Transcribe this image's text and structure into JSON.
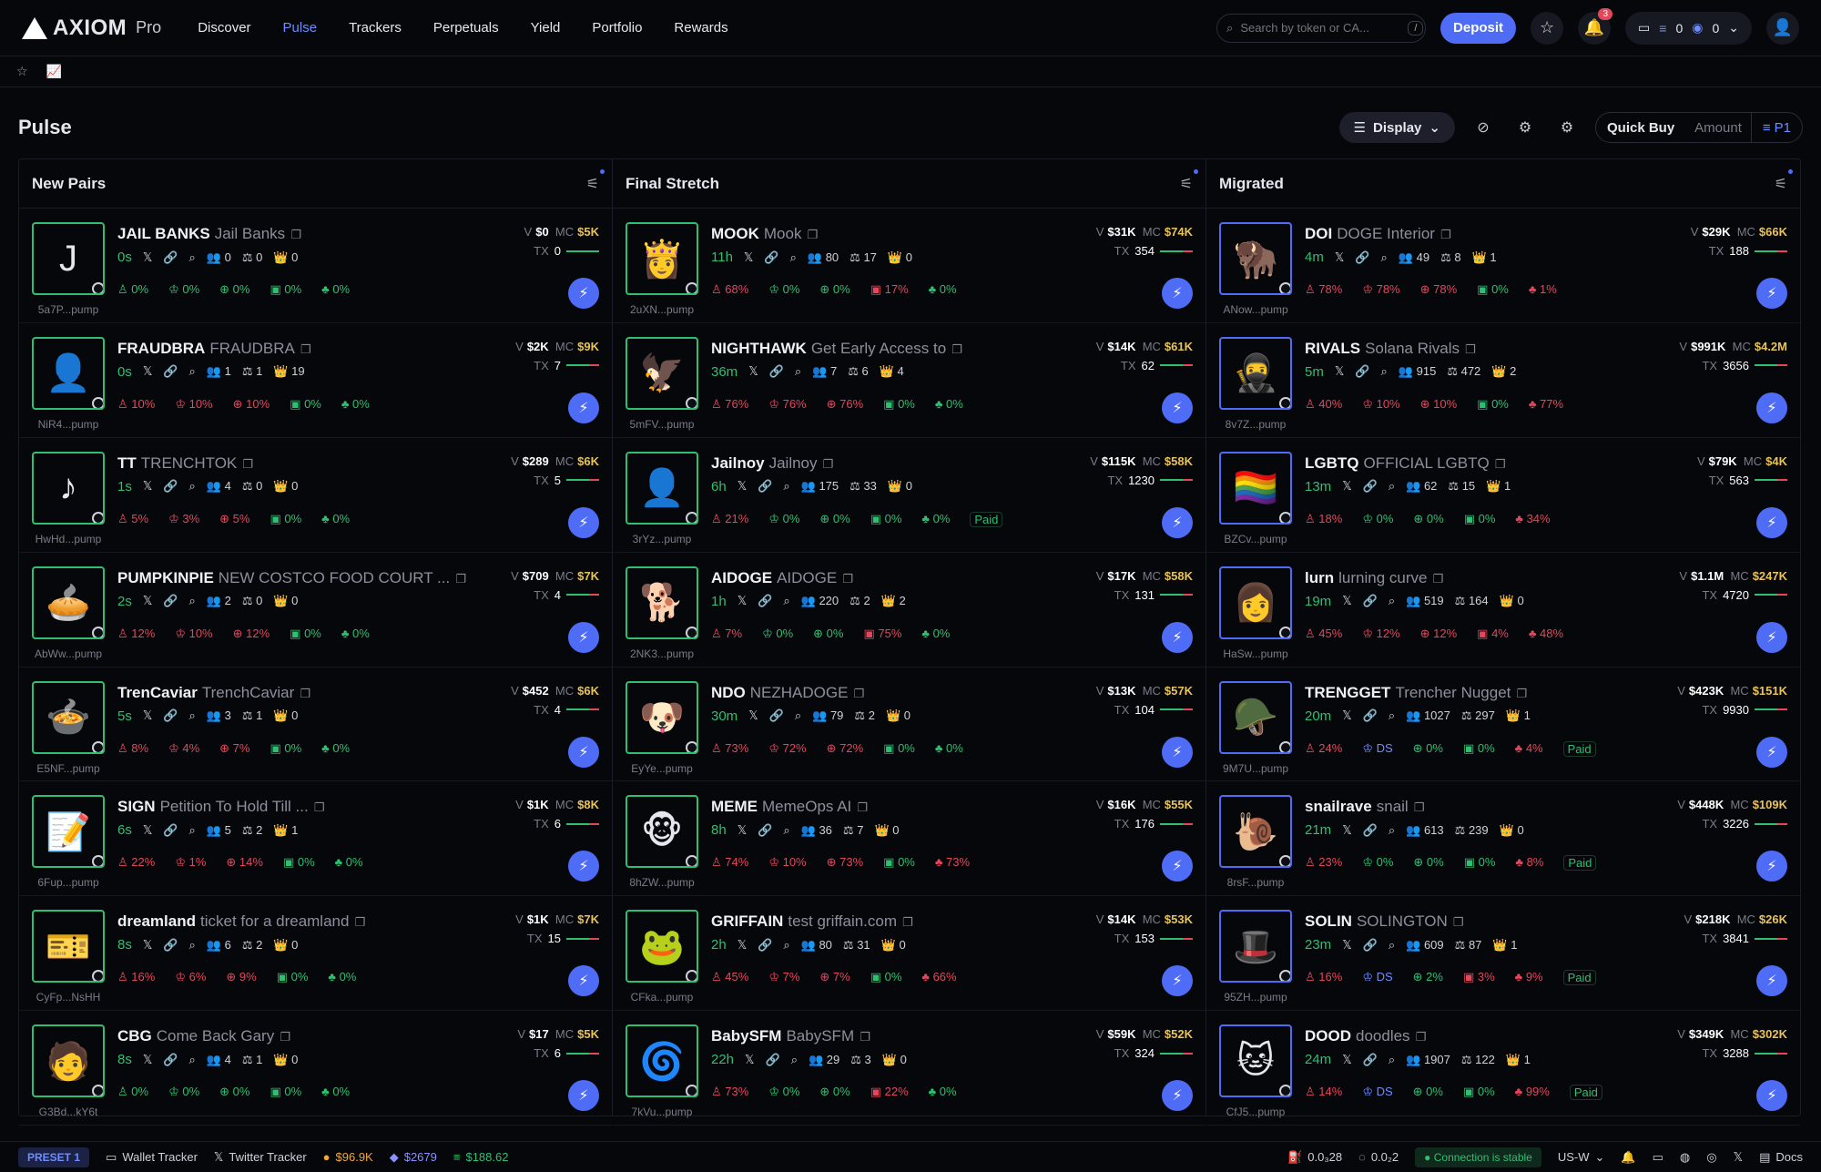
{
  "app": {
    "brand": "AXIOM",
    "brand_sub": "Pro"
  },
  "nav": [
    "Discover",
    "Pulse",
    "Trackers",
    "Perpetuals",
    "Yield",
    "Portfolio",
    "Rewards"
  ],
  "nav_active": "Pulse",
  "search": {
    "placeholder": "Search by token or CA...",
    "shortcut": "/"
  },
  "deposit_label": "Deposit",
  "notifications": "3",
  "wallet": {
    "sol": "0",
    "usdc": "0"
  },
  "page_title": "Pulse",
  "display_label": "Display",
  "quick_buy": {
    "label": "Quick Buy",
    "amount_placeholder": "Amount",
    "preset": "P1"
  },
  "columns": [
    {
      "title": "New Pairs",
      "rows": [
        {
          "sym": "JAIL BANKS",
          "name": "Jail Banks",
          "addr": "5a7P...pump",
          "age": "0s",
          "holders": "0",
          "pro": "0",
          "bundlers": "0",
          "p1": "0%",
          "p2": "0%",
          "p3": "0%",
          "p4": "0%",
          "p5": "0%",
          "v": "$0",
          "mc": "$5K",
          "tx": "0",
          "art": "J",
          "p3red": false
        },
        {
          "sym": "FRAUDBRA",
          "name": "FRAUDBRA",
          "addr": "NiR4...pump",
          "age": "0s",
          "holders": "1",
          "pro": "1",
          "bundlers": "19",
          "p1": "10%",
          "p2": "10%",
          "p3": "10%",
          "p4": "0%",
          "p5": "0%",
          "v": "$2K",
          "mc": "$9K",
          "tx": "7",
          "art": "👤",
          "p3red": true
        },
        {
          "sym": "TT",
          "name": "TRENCHTOK",
          "addr": "HwHd...pump",
          "age": "1s",
          "holders": "4",
          "pro": "0",
          "bundlers": "0",
          "p1": "5%",
          "p2": "3%",
          "p3": "5%",
          "p4": "0%",
          "p5": "0%",
          "v": "$289",
          "mc": "$6K",
          "tx": "5",
          "art": "♪",
          "p3red": true
        },
        {
          "sym": "PUMPKINPIE",
          "name": "NEW COSTCO FOOD COURT ...",
          "addr": "AbWw...pump",
          "age": "2s",
          "holders": "2",
          "pro": "0",
          "bundlers": "0",
          "p1": "12%",
          "p2": "10%",
          "p3": "12%",
          "p4": "0%",
          "p5": "0%",
          "v": "$709",
          "mc": "$7K",
          "tx": "4",
          "art": "🥧",
          "p3red": true
        },
        {
          "sym": "TrenCaviar",
          "name": "TrenchCaviar",
          "addr": "E5NF...pump",
          "age": "5s",
          "holders": "3",
          "pro": "1",
          "bundlers": "0",
          "p1": "8%",
          "p2": "4%",
          "p3": "7%",
          "p4": "0%",
          "p5": "0%",
          "v": "$452",
          "mc": "$6K",
          "tx": "4",
          "art": "🍲",
          "p3red": true
        },
        {
          "sym": "SIGN",
          "name": "Petition To Hold Till ...",
          "addr": "6Fup...pump",
          "age": "6s",
          "holders": "5",
          "pro": "2",
          "bundlers": "1",
          "p1": "22%",
          "p2": "1%",
          "p3": "14%",
          "p4": "0%",
          "p5": "0%",
          "v": "$1K",
          "mc": "$8K",
          "tx": "6",
          "art": "📝",
          "p3red": true
        },
        {
          "sym": "dreamland",
          "name": "ticket for a dreamland",
          "addr": "CyFp...NsHH",
          "age": "8s",
          "holders": "6",
          "pro": "2",
          "bundlers": "0",
          "p1": "16%",
          "p2": "6%",
          "p3": "9%",
          "p4": "0%",
          "p5": "0%",
          "v": "$1K",
          "mc": "$7K",
          "tx": "15",
          "art": "🎫",
          "p3red": true
        },
        {
          "sym": "CBG",
          "name": "Come Back Gary",
          "addr": "G3Bd...kY6t",
          "age": "8s",
          "holders": "4",
          "pro": "1",
          "bundlers": "0",
          "p1": "0%",
          "p2": "0%",
          "p3": "0%",
          "p4": "0%",
          "p5": "0%",
          "v": "$17",
          "mc": "$5K",
          "tx": "6",
          "art": "🧑",
          "p3red": false
        }
      ]
    },
    {
      "title": "Final Stretch",
      "rows": [
        {
          "sym": "MOOK",
          "name": "Mook",
          "addr": "2uXN...pump",
          "age": "11h",
          "holders": "80",
          "pro": "17",
          "bundlers": "0",
          "p1": "68%",
          "p2": "0%",
          "p3": "0%",
          "p4": "17%",
          "p5": "0%",
          "v": "$31K",
          "mc": "$74K",
          "tx": "354",
          "art": "👸",
          "p3red": false
        },
        {
          "sym": "NIGHTHAWK",
          "name": "Get Early Access to",
          "addr": "5mFV...pump",
          "age": "36m",
          "holders": "7",
          "pro": "6",
          "bundlers": "4",
          "p1": "76%",
          "p2": "76%",
          "p3": "76%",
          "p4": "0%",
          "p5": "0%",
          "v": "$14K",
          "mc": "$61K",
          "tx": "62",
          "art": "🦅",
          "p3red": true
        },
        {
          "sym": "Jailnoy",
          "name": "Jailnoy",
          "addr": "3rYz...pump",
          "age": "6h",
          "holders": "175",
          "pro": "33",
          "bundlers": "0",
          "p1": "21%",
          "p2": "0%",
          "p3": "0%",
          "p4": "0%",
          "p5": "0%",
          "v": "$115K",
          "mc": "$58K",
          "tx": "1230",
          "art": "👤",
          "p3red": false,
          "paid": "Paid"
        },
        {
          "sym": "AIDOGE",
          "name": "AIDOGE",
          "addr": "2NK3...pump",
          "age": "1h",
          "holders": "220",
          "pro": "2",
          "bundlers": "2",
          "p1": "7%",
          "p2": "0%",
          "p3": "0%",
          "p4": "75%",
          "p5": "0%",
          "v": "$17K",
          "mc": "$58K",
          "tx": "131",
          "art": "🐕",
          "p3red": false
        },
        {
          "sym": "NDO",
          "name": "NEZHADOGE",
          "addr": "EyYe...pump",
          "age": "30m",
          "holders": "79",
          "pro": "2",
          "bundlers": "0",
          "p1": "73%",
          "p2": "72%",
          "p3": "72%",
          "p4": "0%",
          "p5": "0%",
          "v": "$13K",
          "mc": "$57K",
          "tx": "104",
          "art": "🐶",
          "p3red": true
        },
        {
          "sym": "MEME",
          "name": "MemeOps AI",
          "addr": "8hZW...pump",
          "age": "8h",
          "holders": "36",
          "pro": "7",
          "bundlers": "0",
          "p1": "74%",
          "p2": "10%",
          "p3": "73%",
          "p4": "0%",
          "p5": "73%",
          "v": "$16K",
          "mc": "$55K",
          "tx": "176",
          "art": "🐵",
          "p3red": true
        },
        {
          "sym": "GRIFFAIN",
          "name": "test griffain.com",
          "addr": "CFka...pump",
          "age": "2h",
          "holders": "80",
          "pro": "31",
          "bundlers": "0",
          "p1": "45%",
          "p2": "7%",
          "p3": "7%",
          "p4": "0%",
          "p5": "66%",
          "v": "$14K",
          "mc": "$53K",
          "tx": "153",
          "art": "🐸",
          "p3red": true
        },
        {
          "sym": "BabySFM",
          "name": "BabySFM",
          "addr": "7kVu...pump",
          "age": "22h",
          "holders": "29",
          "pro": "3",
          "bundlers": "0",
          "p1": "73%",
          "p2": "0%",
          "p3": "0%",
          "p4": "22%",
          "p5": "0%",
          "v": "$59K",
          "mc": "$52K",
          "tx": "324",
          "art": "🌀",
          "p3red": false
        }
      ]
    },
    {
      "title": "Migrated",
      "rows": [
        {
          "sym": "DOI",
          "name": "DOGE Interior",
          "addr": "ANow...pump",
          "age": "4m",
          "holders": "49",
          "pro": "8",
          "bundlers": "1",
          "p1": "78%",
          "p2": "78%",
          "p3": "78%",
          "p4": "0%",
          "p5": "1%",
          "v": "$29K",
          "mc": "$66K",
          "tx": "188",
          "art": "🦬",
          "p3red": true
        },
        {
          "sym": "RIVALS",
          "name": "Solana Rivals",
          "addr": "8v7Z...pump",
          "age": "5m",
          "holders": "915",
          "pro": "472",
          "bundlers": "2",
          "p1": "40%",
          "p2": "10%",
          "p3": "10%",
          "p4": "0%",
          "p5": "77%",
          "v": "$991K",
          "mc": "$4.2M",
          "tx": "3656",
          "art": "🥷",
          "p3red": true
        },
        {
          "sym": "LGBTQ",
          "name": "OFFICIAL LGBTQ",
          "addr": "BZCv...pump",
          "age": "13m",
          "holders": "62",
          "pro": "15",
          "bundlers": "1",
          "p1": "18%",
          "p2": "0%",
          "p3": "0%",
          "p4": "0%",
          "p5": "34%",
          "v": "$79K",
          "mc": "$4K",
          "tx": "563",
          "art": "🏳️‍🌈",
          "p3red": false
        },
        {
          "sym": "lurn",
          "name": "lurning curve",
          "addr": "HaSw...pump",
          "age": "19m",
          "holders": "519",
          "pro": "164",
          "bundlers": "0",
          "p1": "45%",
          "p2": "12%",
          "p3": "12%",
          "p4": "4%",
          "p5": "48%",
          "v": "$1.1M",
          "mc": "$247K",
          "tx": "4720",
          "art": "👩",
          "p3red": true
        },
        {
          "sym": "TRENGGET",
          "name": "Trencher Nugget",
          "addr": "9M7U...pump",
          "age": "20m",
          "holders": "1027",
          "pro": "297",
          "bundlers": "1",
          "p1": "24%",
          "p2": "DS",
          "p3": "0%",
          "p4": "0%",
          "p5": "4%",
          "v": "$423K",
          "mc": "$151K",
          "tx": "9930",
          "art": "🪖",
          "p3red": false,
          "paid": "Paid",
          "ds": true
        },
        {
          "sym": "snailrave",
          "name": "snail",
          "addr": "8rsF...pump",
          "age": "21m",
          "holders": "613",
          "pro": "239",
          "bundlers": "0",
          "p1": "23%",
          "p2": "0%",
          "p3": "0%",
          "p4": "0%",
          "p5": "8%",
          "v": "$448K",
          "mc": "$109K",
          "tx": "3226",
          "art": "🐌",
          "p3red": false,
          "paid": "Paid"
        },
        {
          "sym": "SOLIN",
          "name": "SOLINGTON",
          "addr": "95ZH...pump",
          "age": "23m",
          "holders": "609",
          "pro": "87",
          "bundlers": "1",
          "p1": "16%",
          "p2": "DS",
          "p3": "2%",
          "p4": "3%",
          "p5": "9%",
          "v": "$218K",
          "mc": "$26K",
          "tx": "3841",
          "art": "🎩",
          "p3red": false,
          "paid": "Paid",
          "ds": true
        },
        {
          "sym": "DOOD",
          "name": "doodles",
          "addr": "CfJ5...pump",
          "age": "24m",
          "holders": "1907",
          "pro": "122",
          "bundlers": "1",
          "p1": "14%",
          "p2": "DS",
          "p3": "0%",
          "p4": "0%",
          "p5": "99%",
          "v": "$349K",
          "mc": "$302K",
          "tx": "3288",
          "art": "🐱",
          "p3red": false,
          "paid": "Paid",
          "ds": true
        }
      ]
    }
  ],
  "footer": {
    "preset": "PRESET 1",
    "wallet_tracker": "Wallet Tracker",
    "twitter_tracker": "Twitter Tracker",
    "btc": "$96.9K",
    "eth": "$2679",
    "sol": "$188.62",
    "gas1": "0.0₃28",
    "gas2": "0.0₂2",
    "connection": "Connection is stable",
    "region": "US-W",
    "docs": "Docs"
  }
}
